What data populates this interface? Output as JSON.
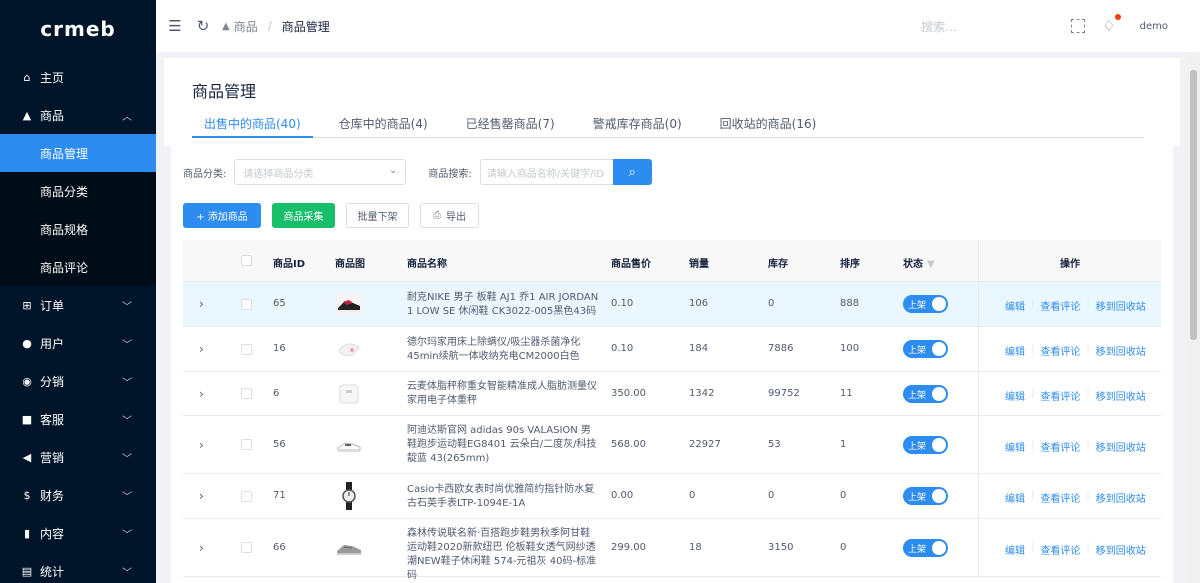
{
  "logo": "crmeb",
  "sidebar": {
    "items": [
      {
        "label": "主页",
        "icon": "home-icon"
      },
      {
        "label": "商品",
        "icon": "shop-icon",
        "expanded": true,
        "children": [
          {
            "label": "商品管理",
            "active": true
          },
          {
            "label": "商品分类"
          },
          {
            "label": "商品规格"
          },
          {
            "label": "商品评论"
          }
        ]
      },
      {
        "label": "订单",
        "icon": "cart-icon"
      },
      {
        "label": "用户",
        "icon": "user-icon"
      },
      {
        "label": "分销",
        "icon": "distribution-icon"
      },
      {
        "label": "客服",
        "icon": "chat-icon"
      },
      {
        "label": "营销",
        "icon": "send-icon"
      },
      {
        "label": "财务",
        "icon": "dollar-icon"
      },
      {
        "label": "内容",
        "icon": "book-icon"
      },
      {
        "label": "统计",
        "icon": "stats-icon"
      }
    ]
  },
  "header": {
    "breadcrumb": [
      "商品",
      "商品管理"
    ],
    "search_placeholder": "搜索...",
    "user": "demo"
  },
  "page": {
    "title": "商品管理",
    "tabs": [
      {
        "label": "出售中的商品(40)",
        "active": true
      },
      {
        "label": "仓库中的商品(4)"
      },
      {
        "label": "已经售罄商品(7)"
      },
      {
        "label": "警戒库存商品(0)"
      },
      {
        "label": "回收站的商品(16)"
      }
    ]
  },
  "filters": {
    "category_label": "商品分类:",
    "category_placeholder": "请选择商品分类",
    "search_label": "商品搜索:",
    "search_placeholder": "请输入商品名称/关键字/ID"
  },
  "buttons": {
    "add": "+  添加商品",
    "collect": "商品采集",
    "batch_off": "批量下架",
    "export": "导出"
  },
  "table": {
    "columns": [
      "商品ID",
      "商品图",
      "商品名称",
      "商品售价",
      "销量",
      "库存",
      "排序",
      "状态",
      "操作"
    ],
    "rows": [
      {
        "id": "65",
        "name": "耐克NIKE 男子 板鞋 AJ1 乔1 AIR JORDAN 1 LOW SE 休闲鞋 CK3022-005黑色43码",
        "price": "0.10",
        "sales": "106",
        "stock": "0",
        "sort": "888",
        "status": "上架",
        "thumb": "sneaker-thumb"
      },
      {
        "id": "16",
        "name": "德尔玛家用床上除螨仪/吸尘器杀菌净化45min续航一体收纳充电CM2000白色",
        "price": "0.10",
        "sales": "184",
        "stock": "7886",
        "sort": "100",
        "status": "上架",
        "thumb": "vacuum-thumb"
      },
      {
        "id": "6",
        "name": "云麦体脂秤称重女智能精准成人脂肪测量仪家用电子体重秤",
        "price": "350.00",
        "sales": "1342",
        "stock": "99752",
        "sort": "11",
        "status": "上架",
        "thumb": "scale-thumb"
      },
      {
        "id": "56",
        "name": "阿迪达斯官网 adidas 90s VALASION 男鞋跑步运动鞋EG8401 云朵白/二度灰/科技靛蓝 43(265mm)",
        "price": "568.00",
        "sales": "22927",
        "stock": "53",
        "sort": "1",
        "status": "上架",
        "thumb": "shoe-thumb"
      },
      {
        "id": "71",
        "name": "Casio卡西欧女表时尚优雅简约指针防水复古石英手表LTP-1094E-1A",
        "price": "0.00",
        "sales": "0",
        "stock": "0",
        "sort": "0",
        "status": "上架",
        "thumb": "watch-thumb"
      },
      {
        "id": "66",
        "name": "森林传说联名新·百搭跑步鞋男秋季阿甘鞋运动鞋2020新款纽巴 伦板鞋女透气网纱透潮NEW鞋子休闲鞋 574-元祖灰 40码-标准码",
        "price": "299.00",
        "sales": "18",
        "stock": "3150",
        "sort": "0",
        "status": "上架",
        "thumb": "runner-thumb"
      }
    ],
    "actions": [
      "编辑",
      "查看评论",
      "移到回收站"
    ]
  }
}
